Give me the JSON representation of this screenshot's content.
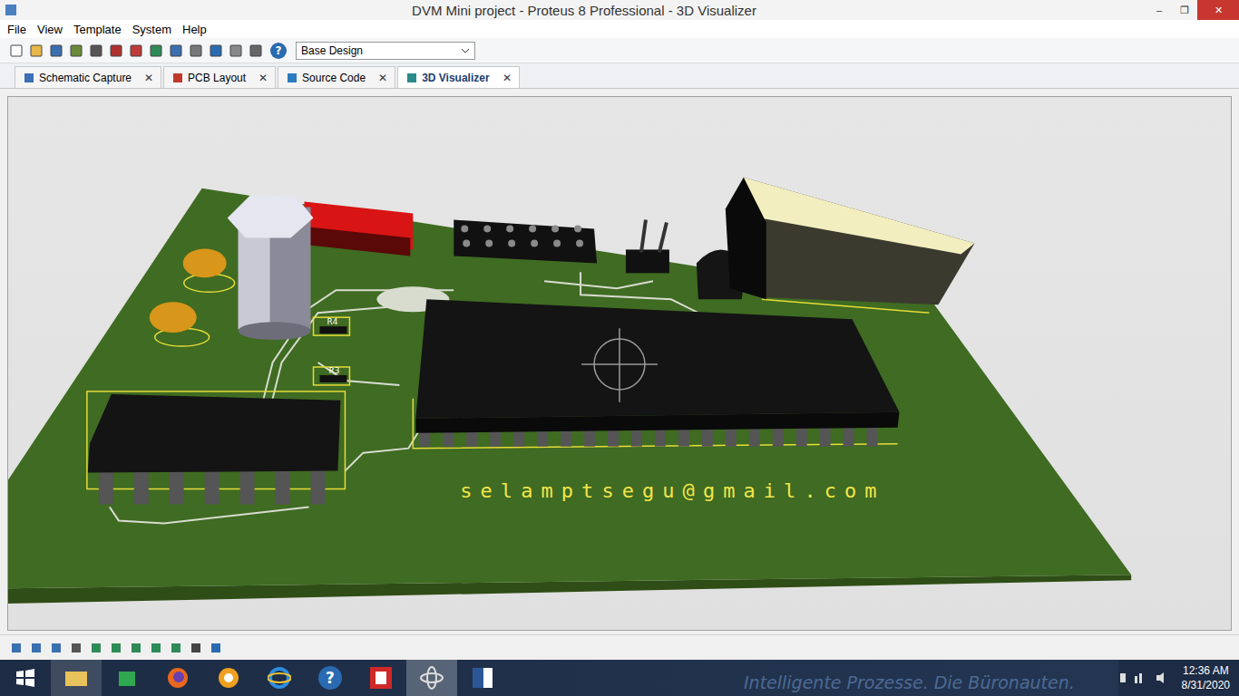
{
  "window": {
    "title": "DVM Mini project - Proteus 8 Professional - 3D Visualizer",
    "controls": [
      "–",
      "❐",
      "✕"
    ]
  },
  "menu": [
    "File",
    "View",
    "Template",
    "System",
    "Help"
  ],
  "toolbar": {
    "design_variant": "Base Design",
    "help_glyph": "?"
  },
  "tabs": [
    {
      "label": "Schematic Capture",
      "selected": false,
      "color": "#3b6fb6"
    },
    {
      "label": "PCB Layout",
      "selected": false,
      "color": "#c0392b"
    },
    {
      "label": "Source Code",
      "selected": false,
      "color": "#2b7bc0"
    },
    {
      "label": "3D Visualizer",
      "selected": true,
      "color": "#2a8a8a"
    }
  ],
  "tab_close": "✕",
  "scene": {
    "silkscreen_text": "selamptsegu@gmail.com",
    "labels": [
      "R4",
      "R3"
    ]
  },
  "taskbar": {
    "time": "12:36 AM",
    "date": "8/31/2020",
    "help_glyph": "?",
    "wallpaper_text": "Intelligente Prozesse. Die Büronauten."
  }
}
